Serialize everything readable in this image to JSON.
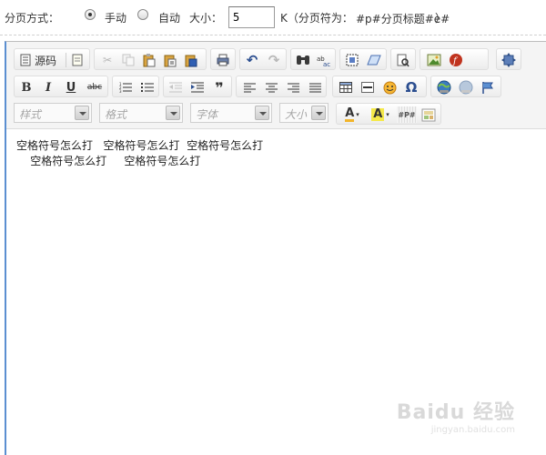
{
  "paging": {
    "label": "分页方式：",
    "manual_label": "手动",
    "auto_label": "自动",
    "size_label": "大小：",
    "size_value": "5",
    "unit_label": "K（分页符为：",
    "separator_text": "#p#分页标题#e#",
    "close_paren": "）",
    "selected_mode": "manual"
  },
  "toolbar": {
    "source_label": "源码",
    "style_placeholder": "样式",
    "format_placeholder": "格式",
    "font_placeholder": "字体",
    "size_placeholder": "大小",
    "row1_icons": [
      "source-icon",
      "document-icon",
      "cut-icon",
      "copy-icon",
      "paste-icon",
      "paste-text-icon",
      "paste-word-icon",
      "print-icon",
      "undo-icon",
      "redo-icon",
      "find-icon",
      "replace-icon",
      "select-all-icon",
      "remove-format-icon",
      "preview-icon",
      "image-icon",
      "flash-icon",
      "maximize-icon"
    ],
    "row2_icons": [
      "bold-icon",
      "italic-icon",
      "underline-icon",
      "strike-icon",
      "numbered-list-icon",
      "bulleted-list-icon",
      "outdent-icon",
      "indent-icon",
      "blockquote-icon",
      "align-left-icon",
      "align-center-icon",
      "align-right-icon",
      "justify-icon",
      "table-icon",
      "horizontal-rule-icon",
      "smiley-icon",
      "special-char-icon",
      "link-icon",
      "unlink-icon",
      "anchor-icon"
    ],
    "bold_glyph": "B",
    "italic_glyph": "I",
    "underline_glyph": "U",
    "strike_glyph": "abc",
    "quote_glyph": "❞",
    "omega_glyph": "Ω",
    "text_color_glyph": "A",
    "bg_color_glyph": "A",
    "page_break_glyph": "#P#"
  },
  "content": {
    "line1": "空格符号怎么打   空格符号怎么打  空格符号怎么打",
    "line2": "    空格符号怎么打     空格符号怎么打"
  },
  "watermark": {
    "brand": "Baidu 经验",
    "url": "jingyan.baidu.com"
  },
  "colors": {
    "editor_left_border": "#5b8fd1",
    "separator_text": "#b5161f"
  }
}
